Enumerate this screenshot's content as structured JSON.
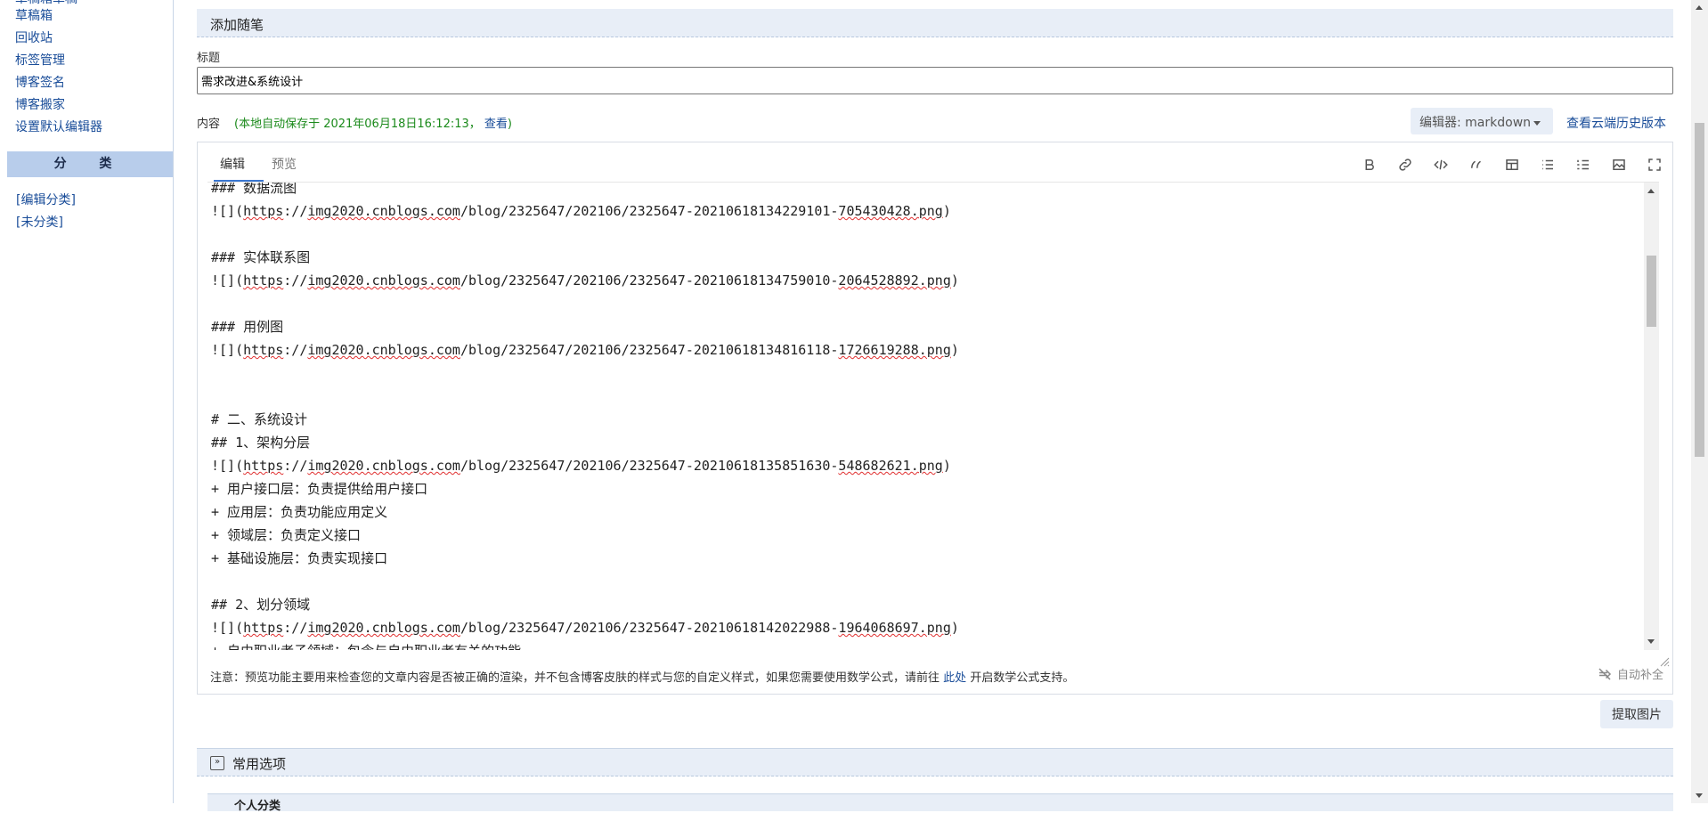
{
  "sidebar": {
    "cut_link": "草稿箱草稿",
    "links": [
      "草稿箱",
      "回收站",
      "标签管理",
      "博客签名",
      "博客搬家",
      "设置默认编辑器"
    ],
    "category_header": "分 类",
    "category_links": [
      "[编辑分类]",
      "[未分类]"
    ]
  },
  "main": {
    "section_title": "添加随笔",
    "title_label": "标题",
    "title_value": "需求改进&系统设计",
    "content_label": "内容",
    "autosave_prefix": "(本地自动保存于 2021年06月18日16:12:13，",
    "autosave_link": "查看",
    "autosave_suffix": ")",
    "editor_select": "编辑器: markdown",
    "history_link": "查看云端历史版本",
    "tabs": {
      "edit": "编辑",
      "preview": "预览"
    },
    "toolbar_icons": [
      "bold-icon",
      "link-icon",
      "code-icon",
      "quote-icon",
      "table-icon",
      "unordered-list-icon",
      "ordered-list-icon",
      "image-icon",
      "fullscreen-icon"
    ],
    "code_lines": [
      {
        "pre": "### 数据流图",
        "u1": "",
        "mid": "",
        "u2": "",
        "post": ""
      },
      {
        "pre": "![](",
        "u1": "https",
        "mid": "://",
        "u2": "img2020.cnblogs.com",
        "post": "/blog/2325647/202106/2325647-20210618134229101-",
        "u3": "705430428.png",
        "end": ")"
      },
      {
        "pre": "",
        "u1": "",
        "mid": "",
        "u2": "",
        "post": ""
      },
      {
        "pre": "### 实体联系图",
        "u1": "",
        "mid": "",
        "u2": "",
        "post": ""
      },
      {
        "pre": "![](",
        "u1": "https",
        "mid": "://",
        "u2": "img2020.cnblogs.com",
        "post": "/blog/2325647/202106/2325647-20210618134759010-",
        "u3": "2064528892.png",
        "end": ")"
      },
      {
        "pre": "",
        "u1": "",
        "mid": "",
        "u2": "",
        "post": ""
      },
      {
        "pre": "### 用例图",
        "u1": "",
        "mid": "",
        "u2": "",
        "post": ""
      },
      {
        "pre": "![](",
        "u1": "https",
        "mid": "://",
        "u2": "img2020.cnblogs.com",
        "post": "/blog/2325647/202106/2325647-20210618134816118-",
        "u3": "1726619288.png",
        "end": ")"
      },
      {
        "pre": "",
        "u1": "",
        "mid": "",
        "u2": "",
        "post": ""
      },
      {
        "pre": "",
        "u1": "",
        "mid": "",
        "u2": "",
        "post": ""
      },
      {
        "pre": "# 二、系统设计",
        "u1": "",
        "mid": "",
        "u2": "",
        "post": ""
      },
      {
        "pre": "## 1、架构分层",
        "u1": "",
        "mid": "",
        "u2": "",
        "post": ""
      },
      {
        "pre": "![](",
        "u1": "https",
        "mid": "://",
        "u2": "img2020.cnblogs.com",
        "post": "/blog/2325647/202106/2325647-20210618135851630-",
        "u3": "548682621.png",
        "end": ")"
      },
      {
        "pre": "+ 用户接口层：负责提供给用户接口",
        "u1": "",
        "mid": "",
        "u2": "",
        "post": ""
      },
      {
        "pre": "+ 应用层：负责功能应用定义",
        "u1": "",
        "mid": "",
        "u2": "",
        "post": ""
      },
      {
        "pre": "+ 领域层：负责定义接口",
        "u1": "",
        "mid": "",
        "u2": "",
        "post": ""
      },
      {
        "pre": "+ 基础设施层：负责实现接口",
        "u1": "",
        "mid": "",
        "u2": "",
        "post": ""
      },
      {
        "pre": "",
        "u1": "",
        "mid": "",
        "u2": "",
        "post": ""
      },
      {
        "pre": "## 2、划分领域",
        "u1": "",
        "mid": "",
        "u2": "",
        "post": ""
      },
      {
        "pre": "![](",
        "u1": "https",
        "mid": "://",
        "u2": "img2020.cnblogs.com",
        "post": "/blog/2325647/202106/2325647-20210618142022988-",
        "u3": "1964068697.png",
        "end": ")"
      },
      {
        "pre": "+ 自由职业者子领域：包含与自由职业者有关的功能",
        "u1": "",
        "mid": "",
        "u2": "",
        "post": ""
      }
    ],
    "note_prefix": "注意：预览功能主要用来检查您的文章内容是否被正确的渲染，并不包含博客皮肤的样式与您的自定义样式，如果您需要使用数学公式，请前往",
    "note_link": "此处",
    "note_suffix": "开启数学公式支持。",
    "autocomplete_label": "自动补全",
    "extract_button": "提取图片",
    "options_title": "常用选项",
    "options_toggle": "»",
    "personal_category": "个人分类"
  }
}
